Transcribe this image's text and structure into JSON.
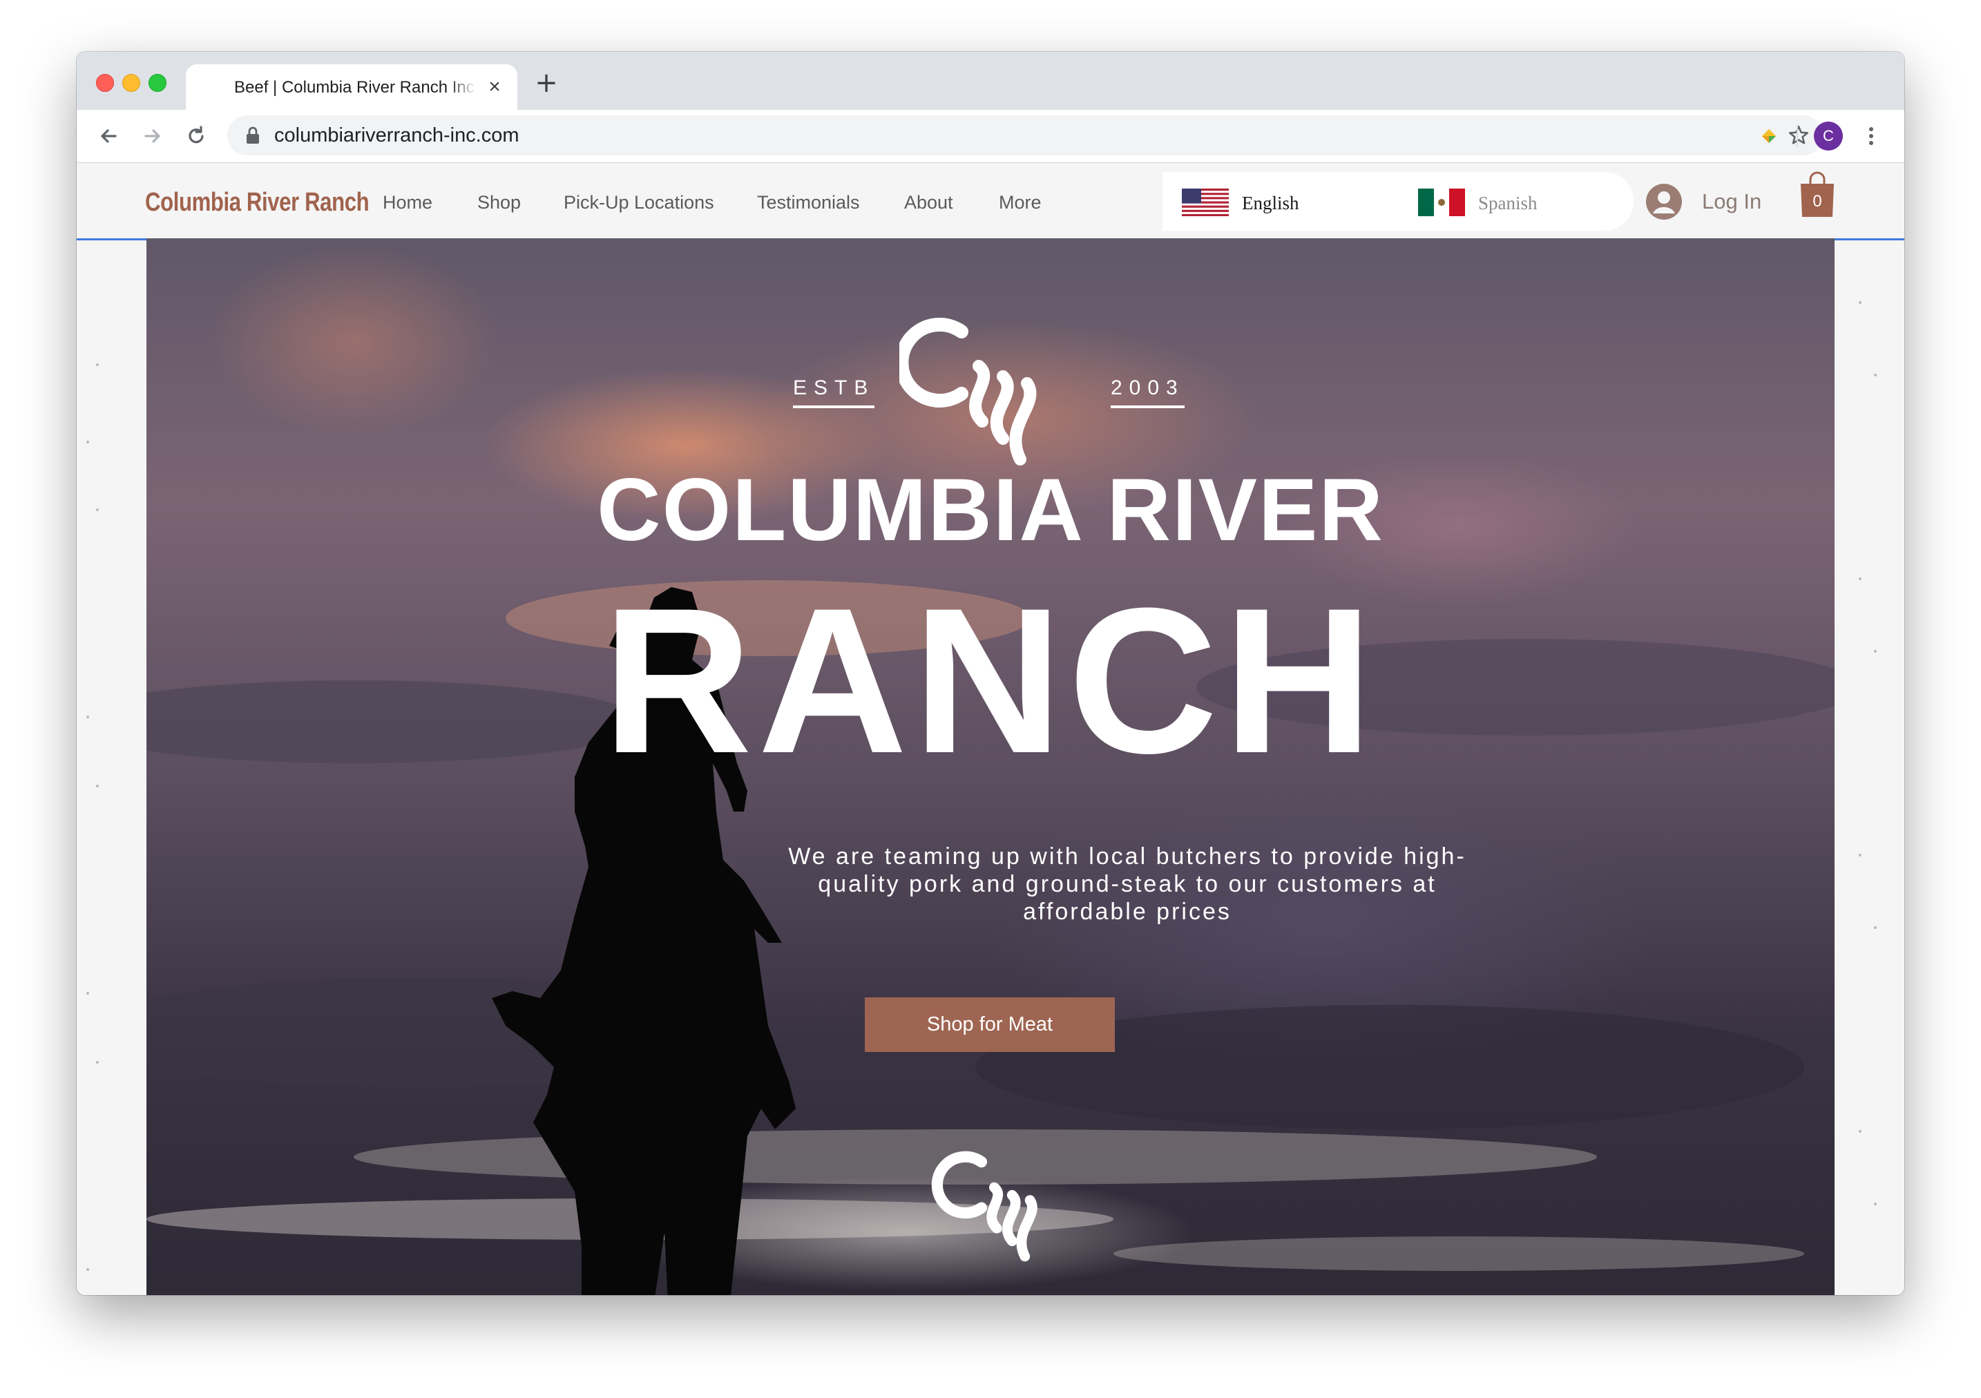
{
  "browser": {
    "tab_title": "Beef | Columbia River Ranch Inc",
    "tab_close": "×",
    "new_tab": "+",
    "url": "columbiariverranch-inc.com",
    "profile_initial": "C"
  },
  "site": {
    "logo": "Columbia River Ranch",
    "menu": [
      "Home",
      "Shop",
      "Pick-Up Locations",
      "Testimonials",
      "About",
      "More"
    ],
    "languages": {
      "english": "English",
      "spanish": "Spanish"
    },
    "login": "Log In",
    "cart_count": "0"
  },
  "hero": {
    "estb": "ESTB",
    "year": "2003",
    "title_line1": "COLUMBIA RIVER",
    "title_line2": "RANCH",
    "tagline": "We are teaming up with local butchers to provide high-quality pork and ground-steak to our customers at affordable prices",
    "cta": "Shop for Meat"
  },
  "colors": {
    "brand": "#a0634d",
    "cta_bg": "#9e6552",
    "accent_line": "#3d7be0"
  }
}
